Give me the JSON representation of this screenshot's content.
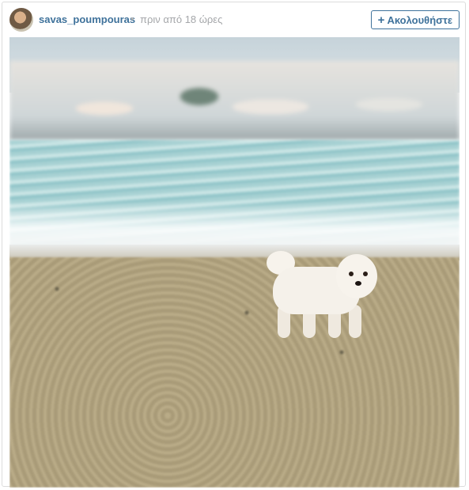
{
  "post": {
    "username": "savas_poumpouras",
    "separator": "•",
    "timestamp": "πριν από 18 ώρες",
    "follow_button": {
      "icon": "+",
      "label": "Ακολουθήστε"
    }
  },
  "photo": {
    "subject_icon": "dog-on-beach-photo"
  },
  "colors": {
    "link": "#3f729b",
    "muted": "#a5a7aa"
  }
}
